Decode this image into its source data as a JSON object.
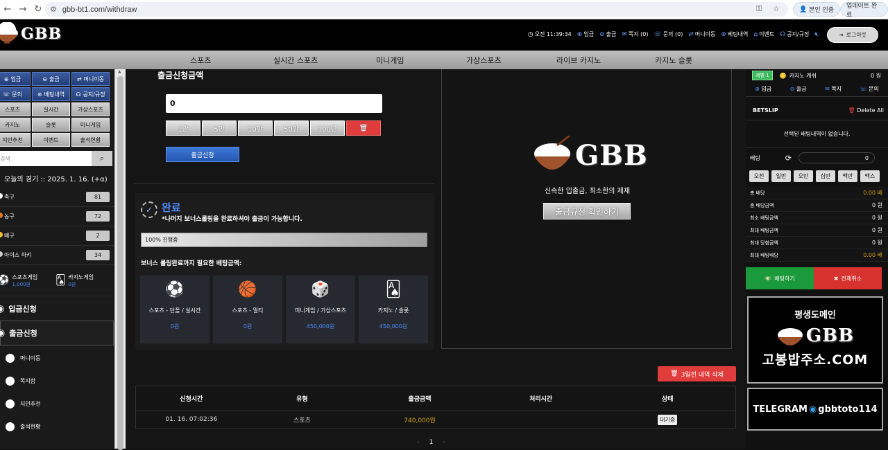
{
  "browser": {
    "url": "gbb-bt1.com/withdraw",
    "btn_auth": "본인 인증",
    "btn_update": "업데이트 완료"
  },
  "logo": {
    "text": "GBB"
  },
  "top_links": {
    "time": "오전 11:39:34",
    "deposit": "입금",
    "withdraw": "출금",
    "note": "쪽지 (0)",
    "inquiry": "문의 (0)",
    "money_move": "머니이동",
    "bet_history": "베팅내역",
    "event": "이벤트",
    "notice": "공지/규정",
    "logout": "로그아웃"
  },
  "main_nav": [
    "스포츠",
    "실시간 스포츠",
    "미니게임",
    "가상스포츠",
    "라이브 카지노",
    "카지노 슬롯"
  ],
  "sidebar": {
    "buttons": [
      {
        "label": "입금",
        "style": "blue"
      },
      {
        "label": "출금",
        "style": "blue"
      },
      {
        "label": "머니이동",
        "style": "blue"
      },
      {
        "label": "문의",
        "style": "blue"
      },
      {
        "label": "베팅내역",
        "style": "blue"
      },
      {
        "label": "공지/규정",
        "style": "blue"
      },
      {
        "label": "스포츠",
        "style": "gray"
      },
      {
        "label": "실시간",
        "style": "gray"
      },
      {
        "label": "가상스포츠",
        "style": "gray"
      },
      {
        "label": "카지노",
        "style": "gray"
      },
      {
        "label": "슬롯",
        "style": "gray"
      },
      {
        "label": "미니게임",
        "style": "gray"
      },
      {
        "label": "지인추천",
        "style": "gray"
      },
      {
        "label": "이벤트",
        "style": "gray"
      },
      {
        "label": "출석현황",
        "style": "gray"
      }
    ],
    "search_placeholder": "검색",
    "today": "오늘의 경기 :: 2025. 1. 16. (+α)",
    "sports": [
      {
        "name": "축구",
        "count": "81",
        "color": "#ffffff"
      },
      {
        "name": "농구",
        "count": "72",
        "color": "#e8741c"
      },
      {
        "name": "배구",
        "count": "2",
        "color": "#f0c030"
      },
      {
        "name": "아이스 하키",
        "count": "34",
        "color": "#cccccc"
      }
    ],
    "game_sports": "스포츠게임",
    "game_sports_amt": "1,000원",
    "game_casino": "카지노게임",
    "game_casino_amt": "0원",
    "menu_deposit": "입금신청",
    "menu_withdraw": "출금신청",
    "menu_small": [
      "머니이동",
      "쪽지함",
      "지인추천",
      "출석현황"
    ]
  },
  "withdraw": {
    "title": "출금신청금액",
    "amount": "0",
    "amount_buttons": [
      "1만",
      "5만",
      "10만",
      "50만",
      "100만"
    ],
    "submit": "출금신청"
  },
  "status": {
    "title": "완료",
    "subtitle": "*나머지 보너스롤링을 완료하셔야 출금이 가능합니다.",
    "progress_text": "100% 진행중",
    "progress": 1.0,
    "need_label": "보너스 롤링완료까지 필요한 베팅금액:",
    "cards": [
      {
        "icon": "⚽",
        "name": "스포츠 - 단폴 / 실시간",
        "value": "0원"
      },
      {
        "icon": "🏀",
        "name": "스포츠 - 멀티",
        "value": "0원"
      },
      {
        "icon": "🎲",
        "name": "미니게임 / 가상스포츠",
        "value": "450,000원"
      },
      {
        "icon": "🂡",
        "name": "카지노 / 슬롯",
        "value": "450,000원"
      }
    ]
  },
  "right_panel": {
    "logo_text": "GBB",
    "slogan": "신속한 입출금, 최소한의 제재",
    "rule_button": "출금규정 확인하기"
  },
  "history": {
    "delete_button": "3일전 내역 삭제",
    "headers": [
      "신청시간",
      "유형",
      "출금금액",
      "처리시간",
      "상태"
    ],
    "rows": [
      {
        "time": "01. 16. 07:02:36",
        "type": "스포츠",
        "amount": "740,000원",
        "processed": "",
        "status": "대기중"
      }
    ],
    "page": "1"
  },
  "betslip": {
    "level": "레벨 1",
    "casino_cash_label": "카지노 캐쉬",
    "casino_cash": "0 원",
    "links": [
      "입금",
      "출금",
      "쪽지",
      "문의"
    ],
    "title": "BETSLIP",
    "delete_all": "Delete All",
    "empty": "선택된 배팅내역이 없습니다.",
    "bet_label": "배팅",
    "bet_value": "0",
    "chips": [
      "오천",
      "일만",
      "오만",
      "십만",
      "백만",
      "맥스"
    ],
    "rows": [
      {
        "label": "총 배당",
        "value": "0.00 배",
        "gold": true
      },
      {
        "label": "총 배당금액",
        "value": "0 원",
        "gold": false
      },
      {
        "label": "최소 배팅금액",
        "value": "0 원",
        "gold": false
      },
      {
        "label": "최대 배팅금액",
        "value": "0 원",
        "gold": false
      },
      {
        "label": "최대 당첨금액",
        "value": "0 원",
        "gold": false
      },
      {
        "label": "최대 배팅배당",
        "value": "0.00 배",
        "gold": true
      }
    ],
    "bet_button": "배팅하기",
    "cancel_button": "전체취소"
  },
  "banners": {
    "domain_title": "평생도메인",
    "domain_logo": "GBB",
    "domain_text": "고봉밥주소.COM",
    "telegram": "TELEGRAM",
    "telegram_id": "gbbtoto114"
  }
}
